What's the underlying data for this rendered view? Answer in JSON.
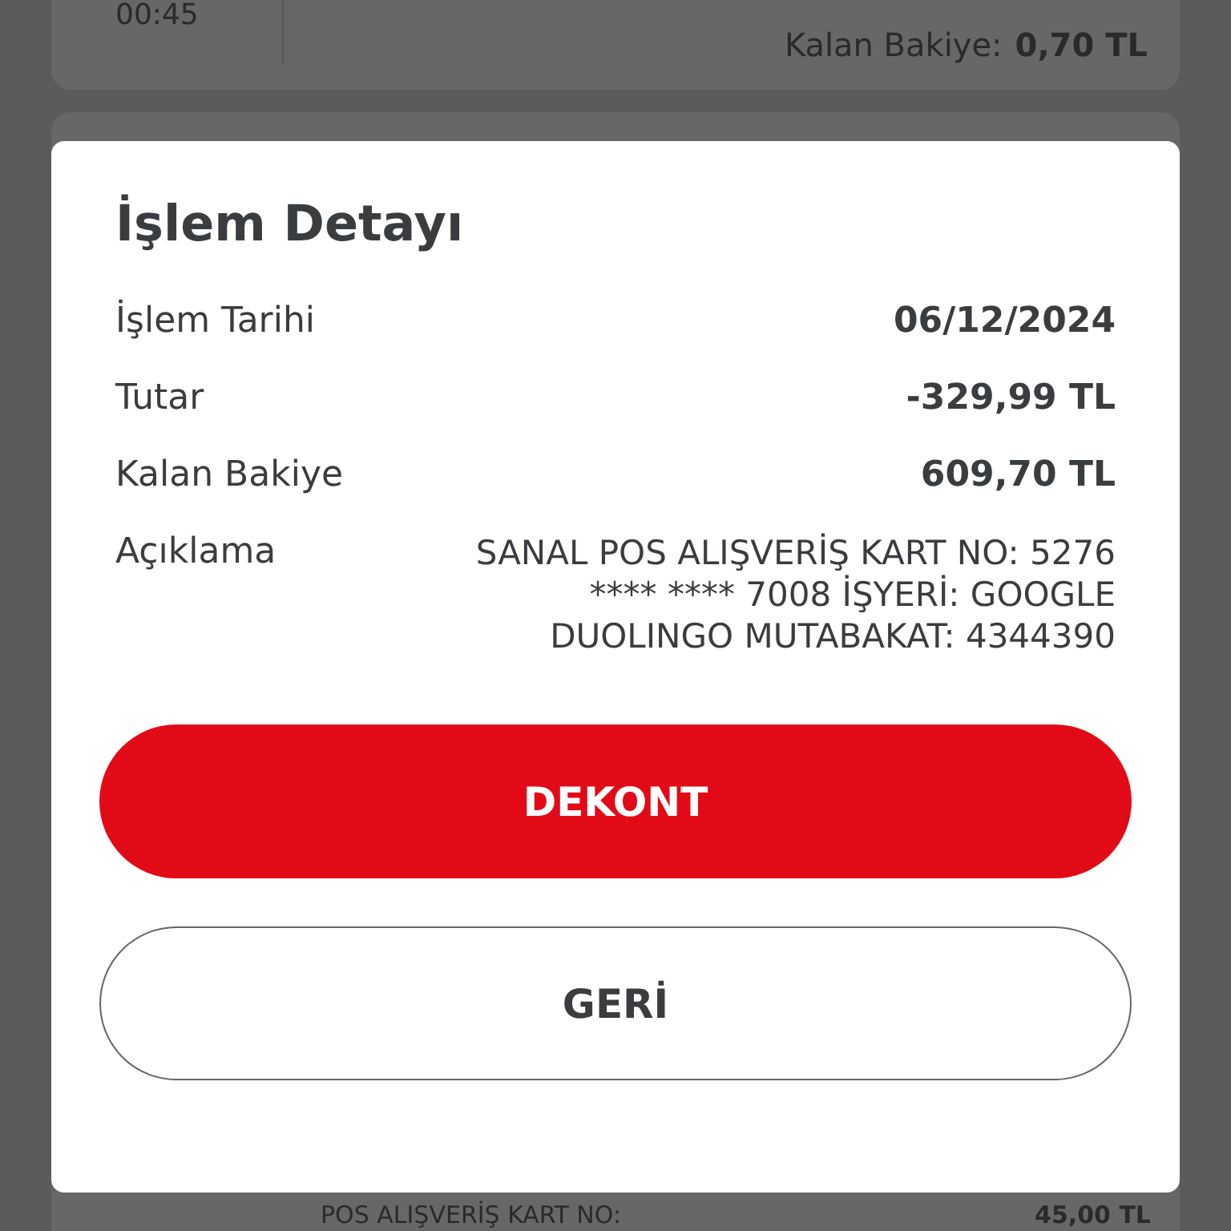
{
  "background": {
    "transactions": [
      {
        "time": "00:45",
        "balance_label": "Kalan Bakiye:",
        "balance": "0,70 TL"
      },
      {
        "description": "POS ALIŞVERİŞ KART NO:",
        "amount": "45,00 TL"
      }
    ]
  },
  "dialog": {
    "title": "İşlem Detayı",
    "rows": [
      {
        "label": "İşlem Tarihi",
        "value": "06/12/2024",
        "kind": "bold"
      },
      {
        "label": "Tutar",
        "value": "-329,99 TL",
        "kind": "bold"
      },
      {
        "label": "Kalan Bakiye",
        "value": "609,70 TL",
        "kind": "bold"
      },
      {
        "label": "Açıklama",
        "value": "SANAL POS ALIŞVERİŞ KART NO: 5276 **** **** 7008 İŞYERİ: GOOGLE DUOLINGO  MUTABAKAT: 4344390",
        "kind": "plain"
      }
    ],
    "buttons": [
      {
        "label": "DEKONT",
        "kind": "primary"
      },
      {
        "label": "GERİ",
        "kind": "secondary"
      }
    ]
  }
}
